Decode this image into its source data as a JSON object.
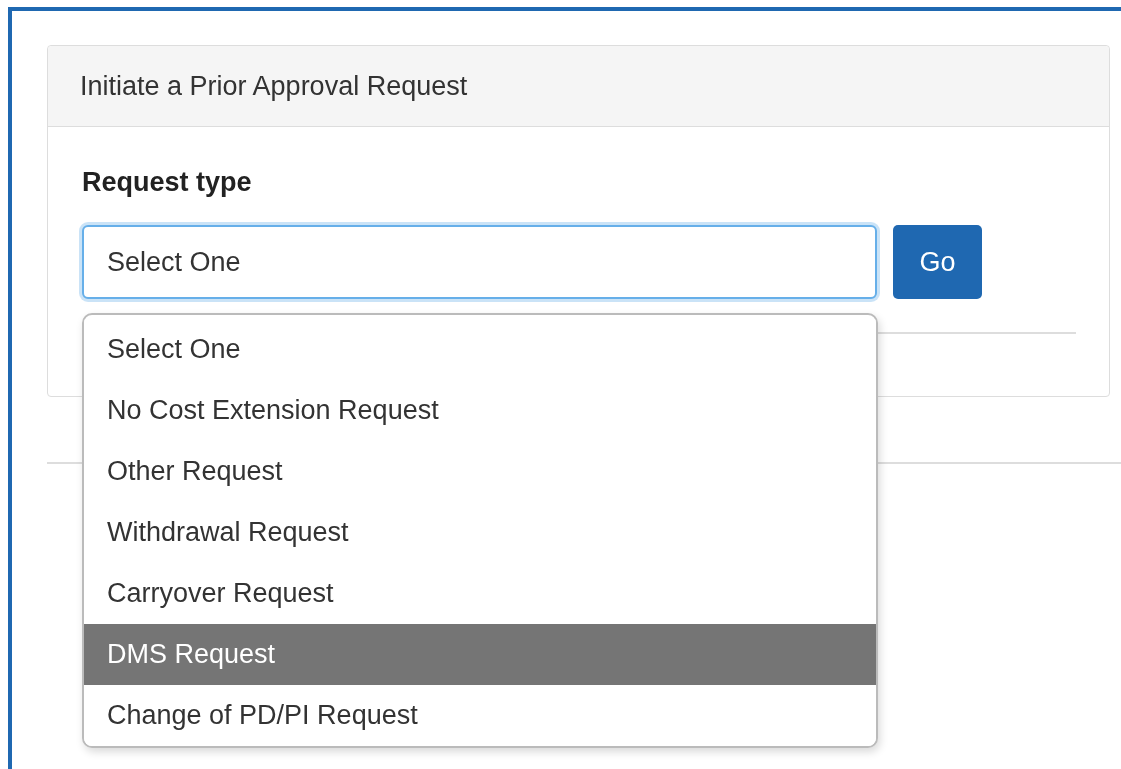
{
  "panel": {
    "title": "Initiate a Prior Approval Request"
  },
  "request_type": {
    "label": "Request type",
    "value": "Select One"
  },
  "go_button": "Go",
  "dropdown": {
    "options": [
      {
        "label": "Select One",
        "selected": false
      },
      {
        "label": "No Cost Extension Request",
        "selected": false
      },
      {
        "label": "Other Request",
        "selected": false
      },
      {
        "label": "Withdrawal Request",
        "selected": false
      },
      {
        "label": "Carryover Request",
        "selected": false
      },
      {
        "label": "DMS Request",
        "selected": true
      },
      {
        "label": "Change of PD/PI Request",
        "selected": false
      }
    ]
  }
}
